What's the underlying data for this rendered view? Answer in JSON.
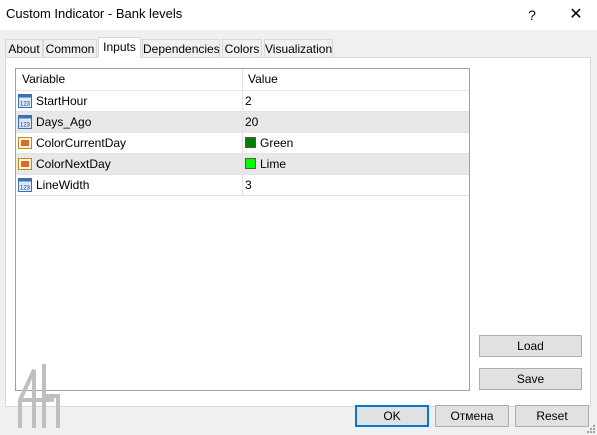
{
  "window": {
    "title": "Custom Indicator - Bank levels",
    "help_label": "?",
    "close_label": "✕"
  },
  "tabs": [
    {
      "label": "About"
    },
    {
      "label": "Common"
    },
    {
      "label": "Inputs"
    },
    {
      "label": "Dependencies"
    },
    {
      "label": "Colors"
    },
    {
      "label": "Visualization"
    }
  ],
  "active_tab": "Inputs",
  "grid": {
    "headers": {
      "variable": "Variable",
      "value": "Value"
    },
    "rows": [
      {
        "name": "StartHour",
        "value": "2",
        "icon": "int-icon"
      },
      {
        "name": "Days_Ago",
        "value": "20",
        "icon": "int-icon"
      },
      {
        "name": "ColorCurrentDay",
        "value": "Green",
        "icon": "color-icon",
        "swatch": "#008000"
      },
      {
        "name": "ColorNextDay",
        "value": "Lime",
        "icon": "color-icon",
        "swatch": "#00ff00"
      },
      {
        "name": "LineWidth",
        "value": "3",
        "icon": "int-icon"
      }
    ]
  },
  "buttons": {
    "load": "Load",
    "save": "Save",
    "ok": "OK",
    "cancel": "Отмена",
    "reset": "Reset"
  },
  "colors": {
    "accent": "#0078d7",
    "row_alt": "#e8e8e8"
  }
}
